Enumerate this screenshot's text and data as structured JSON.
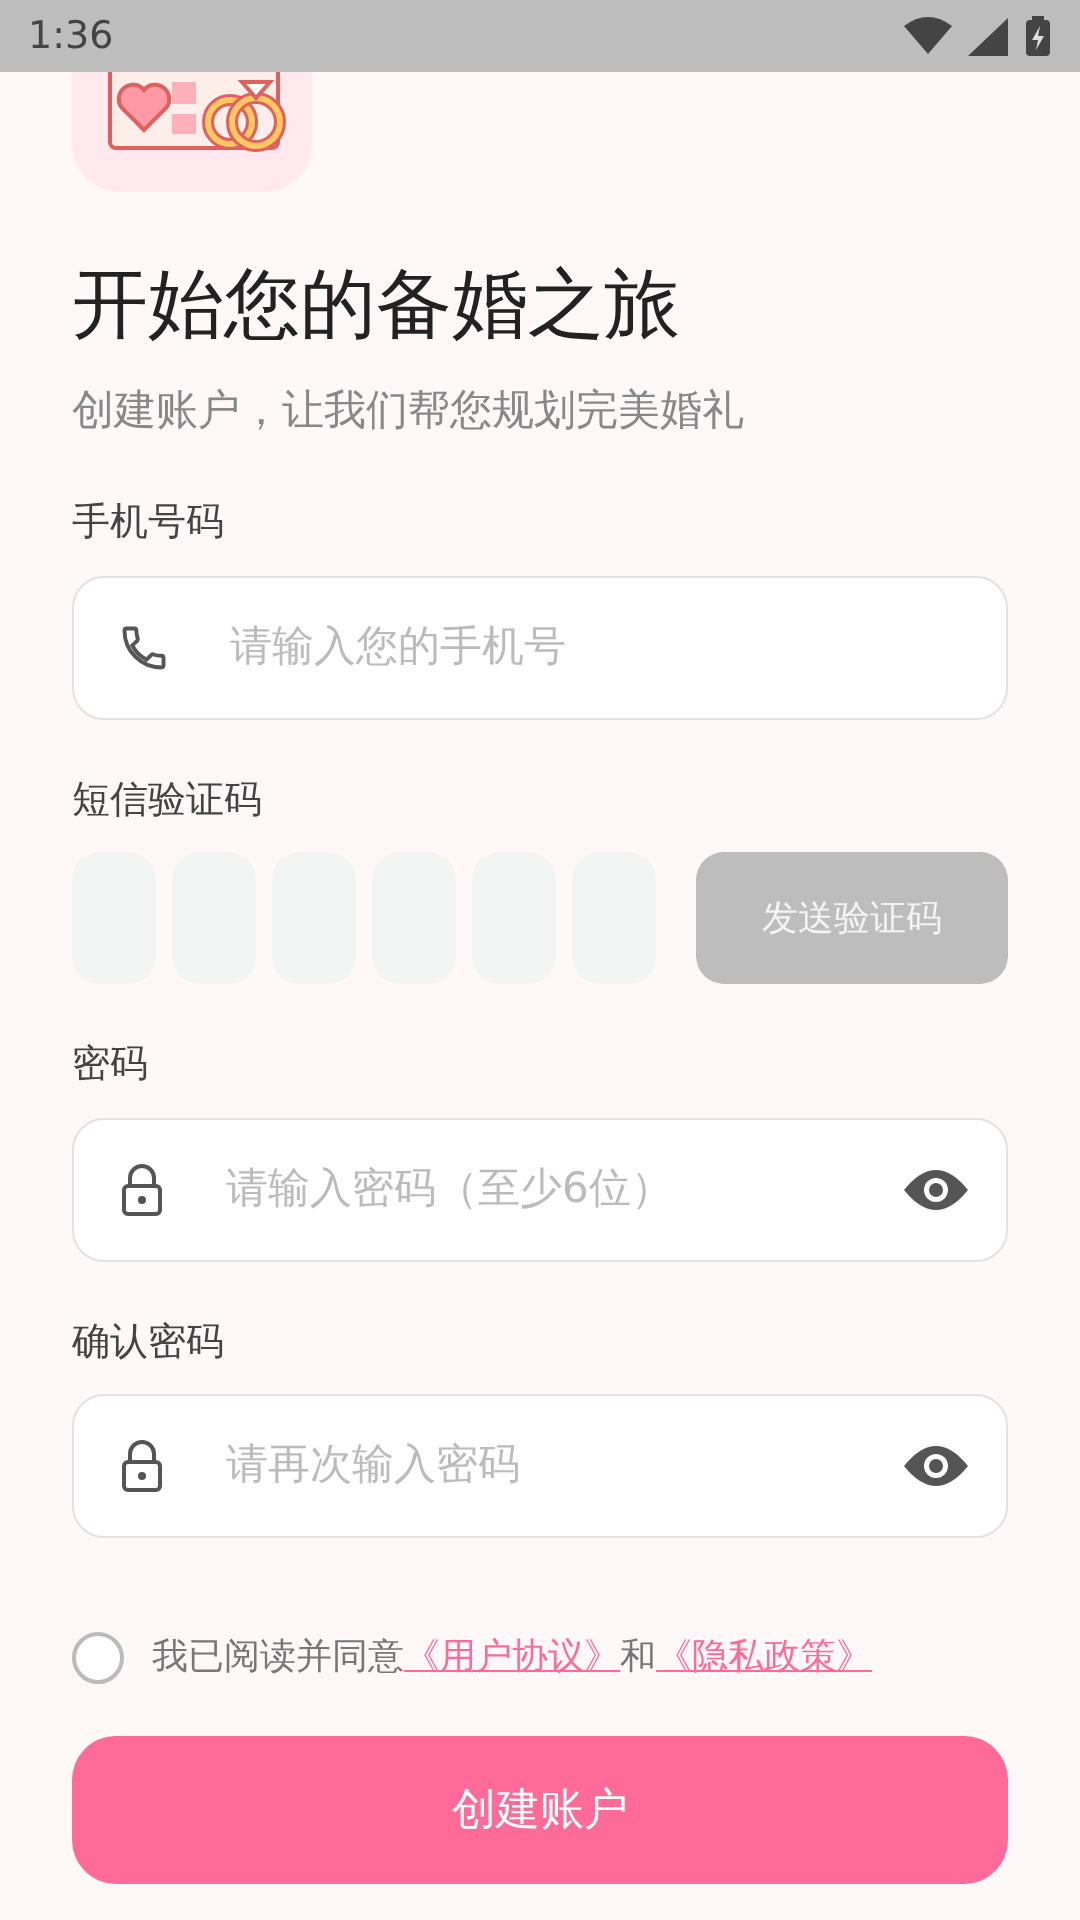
{
  "status_bar": {
    "time": "1:36"
  },
  "title": "开始您的备婚之旅",
  "subtitle": "创建账户，让我们帮您规划完美婚礼",
  "phone": {
    "label": "手机号码",
    "placeholder": "请输入您的手机号"
  },
  "code": {
    "label": "短信验证码",
    "boxes": [
      {
        "filled": false
      },
      {
        "filled": false
      },
      {
        "filled": false
      },
      {
        "filled": false
      },
      {
        "filled": false
      },
      {
        "filled": false
      }
    ],
    "send_button": {
      "label": "发送验证码",
      "disabled": true
    }
  },
  "password": {
    "label": "密码",
    "placeholder": "请输入密码（至少6位）"
  },
  "confirm_password": {
    "label": "确认密码",
    "placeholder": "请再次输入密码"
  },
  "agreement": {
    "checked": false,
    "text": "我已阅读并同意",
    "links": [
      "《用户协议》",
      "《隐私政策》"
    ],
    "joiner": "和"
  },
  "submit_button": "创建账户"
}
